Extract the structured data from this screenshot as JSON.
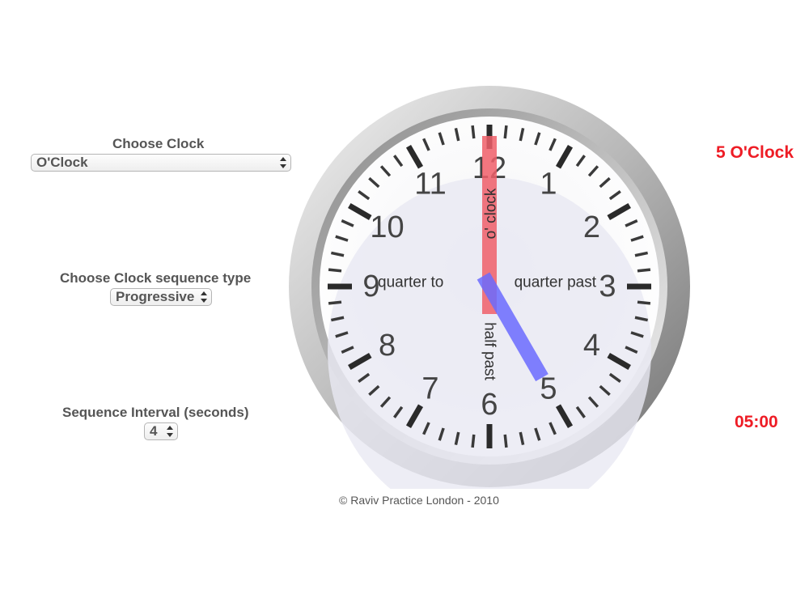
{
  "controls": {
    "choose_clock": {
      "label": "Choose Clock",
      "selected": "O'Clock"
    },
    "sequence_type": {
      "label": "Choose Clock sequence type",
      "selected": "Progressive"
    },
    "interval": {
      "label": "Sequence Interval (seconds)",
      "value": "4"
    }
  },
  "clock": {
    "numbers": [
      "12",
      "1",
      "2",
      "3",
      "4",
      "5",
      "6",
      "7",
      "8",
      "9",
      "10",
      "11"
    ],
    "phrases": {
      "oclock": "o' clock",
      "quarter_past": "quarter past",
      "half_past": "half past",
      "quarter_to": "quarter to"
    },
    "time": {
      "hour": 5,
      "minute": 0
    },
    "hour_hand_color": "#6b6bff",
    "minute_hand_color": "#f0606a"
  },
  "readouts": {
    "time_words": "5 O'Clock",
    "time_digital": "05:00"
  },
  "footer": {
    "copyright": "© Raviv Practice London - 2010"
  },
  "colors": {
    "accent_red": "#ee1c25"
  }
}
